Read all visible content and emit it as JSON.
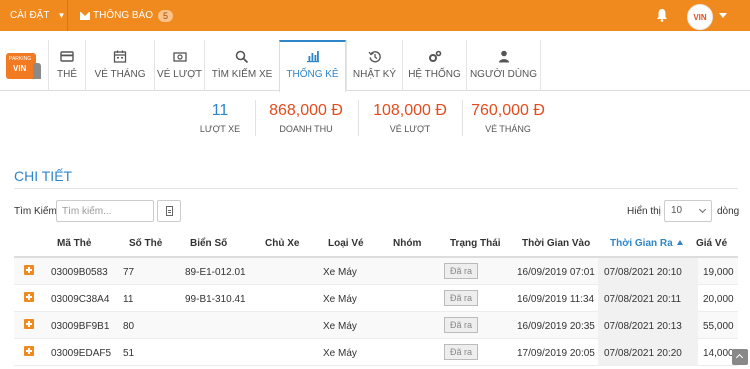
{
  "topbar": {
    "settings_label": "CÀI ĐẶT",
    "notify_label": "THÔNG BÁO",
    "notify_count": "5",
    "avatar_text": "VIN"
  },
  "logo": {
    "top": "PARKING",
    "text": "VIN"
  },
  "nav": {
    "items": [
      {
        "label": "THẺ",
        "icon": "card-icon"
      },
      {
        "label": "VÉ THÁNG",
        "icon": "calendar-icon"
      },
      {
        "label": "VÉ LƯỢT",
        "icon": "ticket-icon"
      },
      {
        "label": "TÌM KIẾM XE",
        "icon": "search-icon"
      },
      {
        "label": "THỐNG KÊ",
        "icon": "bar-chart-icon",
        "active": true
      },
      {
        "label": "NHẬT KÝ",
        "icon": "history-icon"
      },
      {
        "label": "HỆ THỐNG",
        "icon": "gears-icon"
      },
      {
        "label": "NGƯỜI DÙNG",
        "icon": "user-icon"
      }
    ]
  },
  "stats": [
    {
      "value": "11",
      "label": "LƯỢT XE",
      "color": "#2e86c9"
    },
    {
      "value": "868,000 Đ",
      "label": "DOANH THU",
      "color": "#e24c1c"
    },
    {
      "value": "108,000 Đ",
      "label": "VÉ LƯỢT",
      "color": "#e24c1c"
    },
    {
      "value": "760,000 Đ",
      "label": "VÉ THÁNG",
      "color": "#e24c1c"
    }
  ],
  "section": {
    "title": "CHI TIẾT"
  },
  "search": {
    "label": "Tìm Kiếm:",
    "placeholder": "Tìm kiếm..."
  },
  "paging": {
    "show_label": "Hiển thị",
    "page_size": "10",
    "rows_label": "dòng"
  },
  "table": {
    "columns": [
      "Mã Thẻ",
      "Số Thẻ",
      "Biển Số",
      "Chủ Xe",
      "Loại Vé",
      "Nhóm",
      "Trạng Thái",
      "Thời Gian Vào",
      "Thời Gian Ra",
      "Giá Vé"
    ],
    "sorted_column": "Thời Gian Ra",
    "rows": [
      {
        "ma_the": "03009B0583",
        "so_the": "77",
        "bien_so": "89-E1-012.01",
        "chu_xe": "",
        "loai_ve": "Xe Máy",
        "nhom": "",
        "trang_thai": "Đã ra",
        "vao": "16/09/2019 07:01",
        "ra": "07/08/2021 20:10",
        "gia": "19,000"
      },
      {
        "ma_the": "03009C38A4",
        "so_the": "11",
        "bien_so": "99-B1-310.41",
        "chu_xe": "",
        "loai_ve": "Xe Máy",
        "nhom": "",
        "trang_thai": "Đã ra",
        "vao": "16/09/2019 11:34",
        "ra": "07/08/2021 20:11",
        "gia": "20,000"
      },
      {
        "ma_the": "03009BF9B1",
        "so_the": "80",
        "bien_so": "",
        "chu_xe": "",
        "loai_ve": "Xe Máy",
        "nhom": "",
        "trang_thai": "Đã ra",
        "vao": "16/09/2019 20:35",
        "ra": "07/08/2021 20:13",
        "gia": "55,000"
      },
      {
        "ma_the": "03009EDAF5",
        "so_the": "51",
        "bien_so": "",
        "chu_xe": "",
        "loai_ve": "Xe Máy",
        "nhom": "",
        "trang_thai": "Đã ra",
        "vao": "17/09/2019 20:05",
        "ra": "07/08/2021 20:20",
        "gia": "14,000"
      }
    ]
  },
  "colors": {
    "accent": "#f08a1e",
    "primary": "#2e86c9",
    "money": "#e24c1c"
  }
}
